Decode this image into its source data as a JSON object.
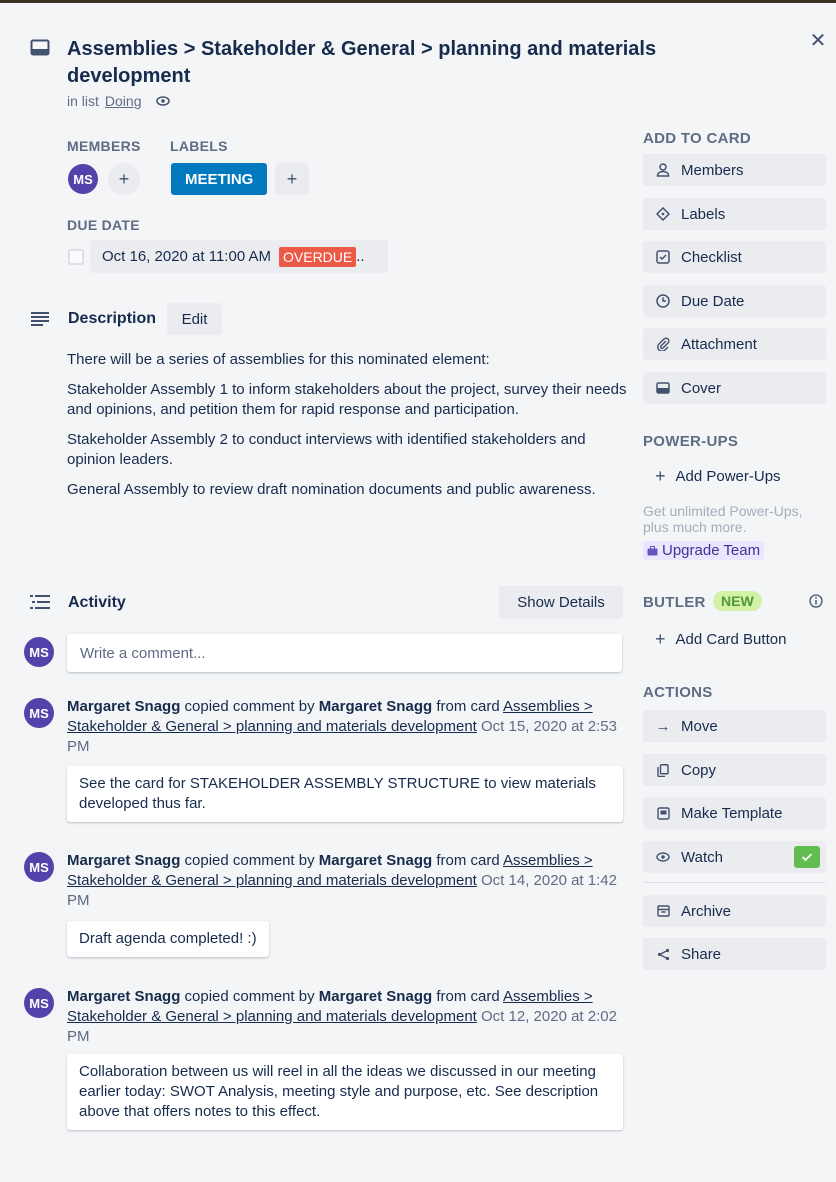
{
  "card": {
    "title_line1": "Assemblies > Stakeholder & General > planning and materials",
    "title_line2": "development",
    "in_list_prefix": "in list",
    "list_name": "Doing"
  },
  "members": {
    "heading": "MEMBERS",
    "initials": "MS"
  },
  "labels": {
    "heading": "LABELS",
    "items": [
      "MEETING"
    ],
    "color": "#0079bf"
  },
  "due": {
    "heading": "DUE DATE",
    "date": "Oct 16, 2020 at 11:00 AM",
    "status": "OVERDUE",
    "ellipsis": ".."
  },
  "description": {
    "title": "Description",
    "edit_label": "Edit",
    "paragraphs": [
      "There will be a series of assemblies for this nominated element:",
      "Stakeholder Assembly 1 to inform stakeholders about the project, survey their needs and opinions, and petition them for rapid response and participation.",
      "Stakeholder Assembly 2 to conduct interviews with identified stakeholders and opinion leaders.",
      "General Assembly to review draft nomination documents and public awareness."
    ]
  },
  "activity": {
    "title": "Activity",
    "show_details_label": "Show Details",
    "comment_placeholder": "Write a comment...",
    "current_user_initials": "MS",
    "entries": [
      {
        "initials": "MS",
        "author": "Margaret Snagg",
        "verb": "copied comment by",
        "source_author": "Margaret Snagg",
        "from_text": "from card",
        "card_link": "Assemblies > Stakeholder & General > planning and materials development",
        "timestamp": "Oct 15, 2020 at 2:53 PM",
        "comment": "See the card for STAKEHOLDER ASSEMBLY STRUCTURE to view materials developed thus far."
      },
      {
        "initials": "MS",
        "author": "Margaret Snagg",
        "verb": "copied comment by",
        "source_author": "Margaret Snagg",
        "from_text": "from card",
        "card_link": "Assemblies > Stakeholder & General > planning and materials development",
        "timestamp": "Oct 14, 2020 at 1:42 PM",
        "comment": "Draft agenda completed! :)"
      },
      {
        "initials": "MS",
        "author": "Margaret Snagg",
        "verb": "copied comment by",
        "source_author": "Margaret Snagg",
        "from_text": "from card",
        "card_link": "Assemblies > Stakeholder & General > planning and materials development",
        "timestamp": "Oct 12, 2020 at 2:02 PM",
        "comment": "Collaboration between us will reel in all the ideas we discussed in our meeting earlier today: SWOT Analysis, meeting style and purpose, etc. See description above that offers notes to this effect."
      }
    ]
  },
  "sidebar": {
    "add_to_card_heading": "ADD TO CARD",
    "add_to_card": [
      "Members",
      "Labels",
      "Checklist",
      "Due Date",
      "Attachment",
      "Cover"
    ],
    "powerups_heading": "POWER-UPS",
    "add_powerups_label": "Add Power-Ups",
    "upsell_text": "Get unlimited Power-Ups, plus much more.",
    "upgrade_label": "Upgrade Team",
    "butler_heading": "BUTLER",
    "butler_badge": "NEW",
    "add_card_button_label": "Add Card Button",
    "actions_heading": "ACTIONS",
    "actions": [
      "Move",
      "Copy",
      "Make Template",
      "Watch"
    ],
    "more_actions": [
      "Archive",
      "Share"
    ]
  }
}
